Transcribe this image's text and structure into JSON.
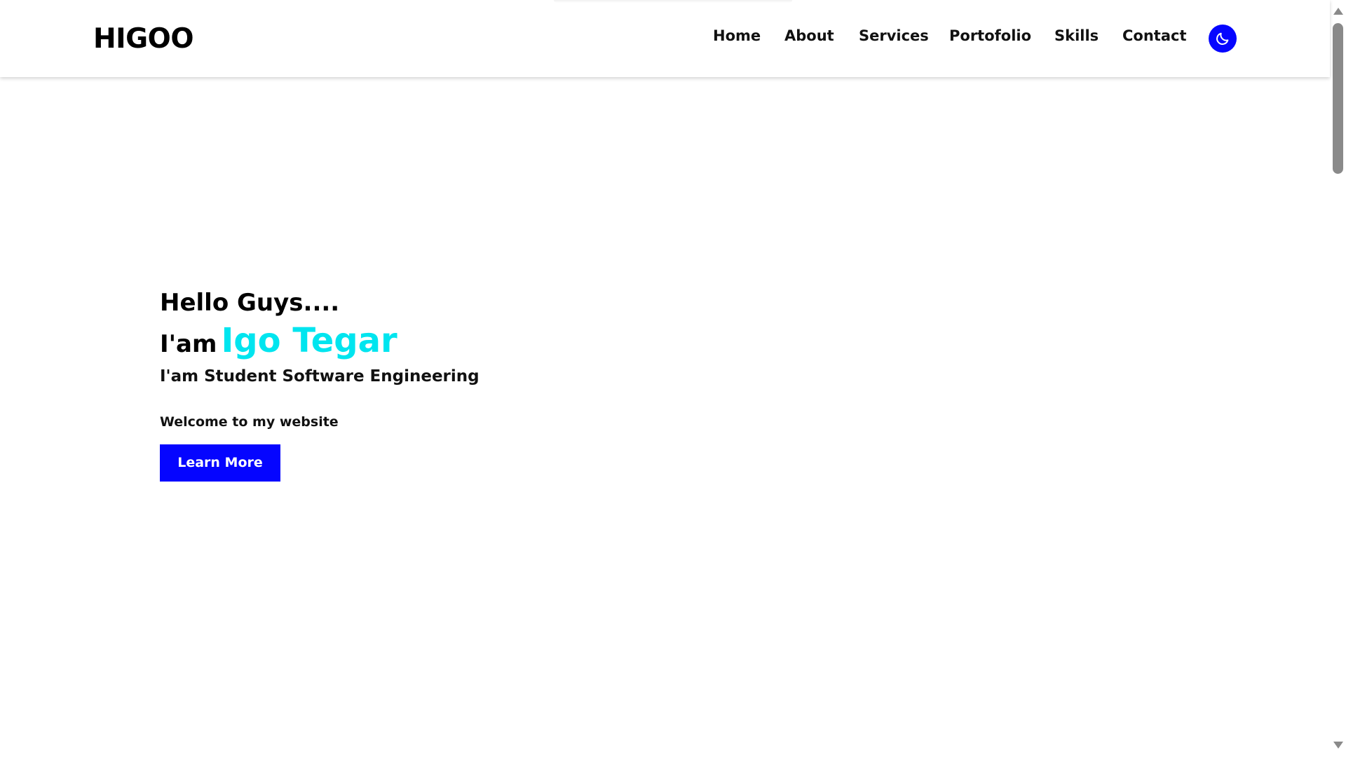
{
  "brand": {
    "logo_text": "HIGOO"
  },
  "nav": {
    "items": [
      {
        "label": "Home"
      },
      {
        "label": "About"
      },
      {
        "label": "Services"
      },
      {
        "label": "Portofolio"
      },
      {
        "label": "Skills"
      },
      {
        "label": "Contact"
      }
    ],
    "theme_toggle_icon": "moon-icon"
  },
  "hero": {
    "greeting": "Hello Guys....",
    "intro_prefix": "I'am",
    "name": "Igo Tegar",
    "role": "I'am Student Software Engineering",
    "welcome": "Welcome to my website",
    "cta_label": "Learn More"
  },
  "colors": {
    "accent": "#0505ff",
    "name_highlight": "#00e5ef",
    "text": "#000000",
    "background": "#ffffff"
  }
}
